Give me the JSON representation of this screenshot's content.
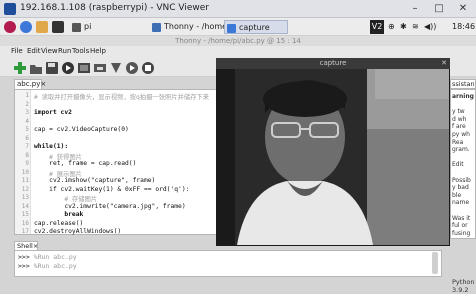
{
  "vnc": {
    "title": "192.168.1.108 (raspberrypi) - VNC Viewer",
    "minimize": "–",
    "maximize": "□",
    "close": "✕"
  },
  "taskbar": {
    "tasks": [
      {
        "label": "pi"
      },
      {
        "label": "Thonny - /home/pi/..."
      },
      {
        "label": "capture"
      }
    ],
    "tray": {
      "time": "18:46",
      "volume": "◀))",
      "bluetooth": "✱",
      "wifi": "≋",
      "vnc": "V2"
    }
  },
  "thonny": {
    "title": "Thonny - /home/pi/abc.py @ 15 : 14"
  },
  "menu": [
    "File",
    "Edit",
    "View",
    "Run",
    "Tools",
    "Help"
  ],
  "editor": {
    "tab": "abc.py",
    "tab_close": "×",
    "lines": [
      {
        "n": "1",
        "t": "# 读取并打开摄像头，显示视频，按q拍摄一张照片并储存下来",
        "c": "cm"
      },
      {
        "n": "2",
        "t": "",
        "c": ""
      },
      {
        "n": "3",
        "t": "import cv2",
        "c": "kw"
      },
      {
        "n": "4",
        "t": "",
        "c": ""
      },
      {
        "n": "5",
        "t": "cap = cv2.VideoCapture(0)",
        "c": ""
      },
      {
        "n": "6",
        "t": "",
        "c": ""
      },
      {
        "n": "7",
        "t": "while(1):",
        "c": "kw"
      },
      {
        "n": "8",
        "t": "    # 获得图片",
        "c": "cm"
      },
      {
        "n": "9",
        "t": "    ret, frame = cap.read()",
        "c": ""
      },
      {
        "n": "10",
        "t": "    # 展示图片",
        "c": "cm"
      },
      {
        "n": "11",
        "t": "    cv2.imshow(\"capture\", frame)",
        "c": ""
      },
      {
        "n": "12",
        "t": "    if cv2.waitKey(1) & 0xFF == ord('q'):",
        "c": ""
      },
      {
        "n": "13",
        "t": "        # 存储图片",
        "c": "cm"
      },
      {
        "n": "14",
        "t": "        cv2.imwrite(\"camera.jpg\", frame)",
        "c": ""
      },
      {
        "n": "15",
        "t": "        break",
        "c": "kw"
      },
      {
        "n": "16",
        "t": "cap.release()",
        "c": ""
      },
      {
        "n": "17",
        "t": "cv2.destroyAllWindows()",
        "c": ""
      }
    ]
  },
  "shell": {
    "tab": "Shell",
    "tab_close": "×",
    "lines": [
      {
        "prompt": ">>>",
        "cmd": "%Run abc.py"
      },
      {
        "prompt": ">>>",
        "cmd": "%Run abc.py"
      }
    ]
  },
  "assistant": {
    "tab": "ssistant",
    "tab_close": "×",
    "lines": [
      "arning",
      "",
      "y tw",
      "d wh",
      "f are",
      "py wh",
      "Rea",
      "gram.",
      "",
      "Edit",
      "",
      "Possib",
      "y bad",
      "ble",
      "name",
      "",
      "Was it",
      "ful or",
      "fusing"
    ]
  },
  "capture": {
    "title": "capture",
    "close": "✕"
  },
  "status": "Python 3.9.2",
  "colors": {
    "accent": "#1f4f9a",
    "raspi": "#b31b4e"
  }
}
